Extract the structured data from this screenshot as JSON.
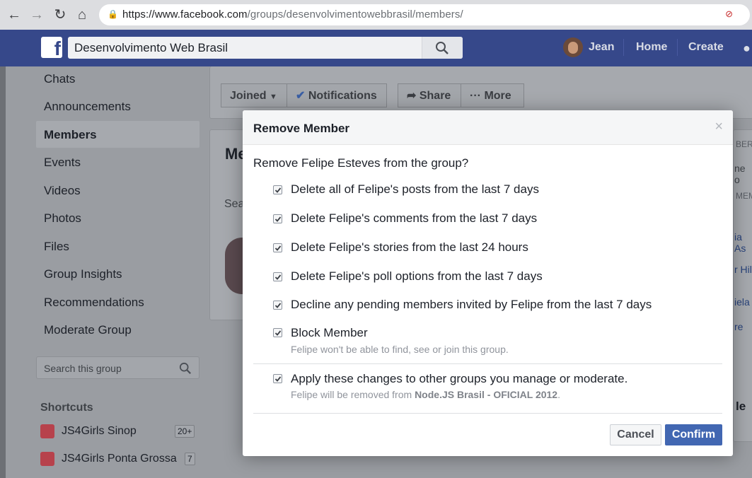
{
  "browser": {
    "url_host": "https://www.facebook.com",
    "url_path": "/groups/desenvolvimentowebbrasil/members/"
  },
  "topbar": {
    "search_value": "Desenvolvimento Web Brasil",
    "user_name": "Jean",
    "home_label": "Home",
    "create_label": "Create"
  },
  "sidebar": {
    "items": [
      "Chats",
      "Announcements",
      "Members",
      "Events",
      "Videos",
      "Photos",
      "Files",
      "Group Insights",
      "Recommendations",
      "Moderate Group"
    ],
    "search_placeholder": "Search this group",
    "shortcuts_title": "Shortcuts",
    "shortcuts": [
      {
        "label": "JS4Girls Sinop",
        "count": "20+"
      },
      {
        "label": "JS4Girls Ponta Grossa",
        "count": "7"
      }
    ]
  },
  "group_actions": {
    "joined": "Joined",
    "notifications": "Notifications",
    "share": "Share",
    "more": "More"
  },
  "background": {
    "members_heading_fragment": "Me",
    "search_fragment": "Sea",
    "right_fragments": [
      "BERS",
      "ne o",
      "MEM",
      "ia As",
      "r Hil",
      "iela",
      "re",
      "le"
    ]
  },
  "modal": {
    "title": "Remove Member",
    "close": "×",
    "question": "Remove Felipe Esteves from the group?",
    "options": [
      {
        "label": "Delete all of Felipe's posts from the last 7 days",
        "checked": true
      },
      {
        "label": "Delete Felipe's comments from the last 7 days",
        "checked": true
      },
      {
        "label": "Delete Felipe's stories from the last 24 hours",
        "checked": true
      },
      {
        "label": "Delete Felipe's poll options from the last 7 days",
        "checked": true
      },
      {
        "label": "Decline any pending members invited by Felipe from the last 7 days",
        "checked": true
      },
      {
        "label": "Block Member",
        "checked": true,
        "note": "Felipe won't be able to find, see or join this group."
      }
    ],
    "apply": {
      "label": "Apply these changes to other groups you manage or moderate.",
      "checked": true,
      "note_prefix": "Felipe will be removed from ",
      "note_group": "Node.JS Brasil - OFICIAL 2012",
      "note_suffix": "."
    },
    "cancel": "Cancel",
    "confirm": "Confirm"
  },
  "colors": {
    "facebook_blue": "#4267b2",
    "topbar": "#36488a"
  }
}
